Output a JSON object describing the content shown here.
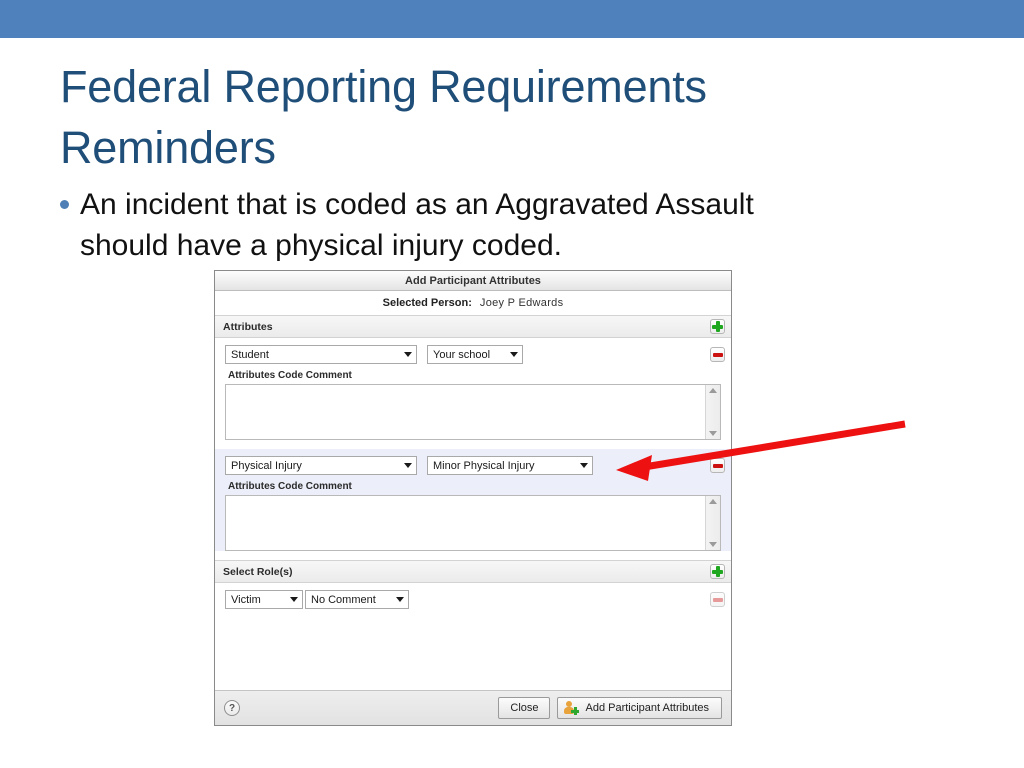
{
  "slide": {
    "title": "Federal Reporting Requirements\nReminders",
    "bullets": [
      "An incident that is coded as an Aggravated Assault\nshould have a physical injury coded."
    ],
    "banner_color": "#4F81BD",
    "title_color": "#1F4E79",
    "bullet_color": "#4F7FB5"
  },
  "dialog": {
    "title": "Add Participant Attributes",
    "selected_person_label": "Selected Person:",
    "selected_person_value": "Joey P Edwards",
    "sections": [
      {
        "header": "Attributes",
        "add_icon": "plus-icon",
        "rows": [
          {
            "code": "Student",
            "value": "Your school",
            "comment_label": "Attributes Code Comment",
            "comment_value": "",
            "remove_icon": "minus-icon",
            "highlighted": false
          },
          {
            "code": "Physical Injury",
            "value": "Minor Physical Injury",
            "comment_label": "Attributes Code Comment",
            "comment_value": "",
            "remove_icon": "minus-icon",
            "highlighted": true
          }
        ]
      },
      {
        "header": "Select Role(s)",
        "add_icon": "plus-icon",
        "rows": [
          {
            "role": "Victim",
            "role_comment": "No Comment",
            "remove_icon": "minus-icon-disabled"
          }
        ]
      }
    ],
    "footer": {
      "help_icon": "question-mark-icon",
      "help_glyph": "?",
      "close_label": "Close",
      "submit_label": "Add Participant Attributes",
      "submit_icon": "add-person-icon"
    }
  },
  "annotation": {
    "type": "arrow",
    "color": "#EE1111",
    "points_to": "Minor Physical Injury dropdown"
  }
}
